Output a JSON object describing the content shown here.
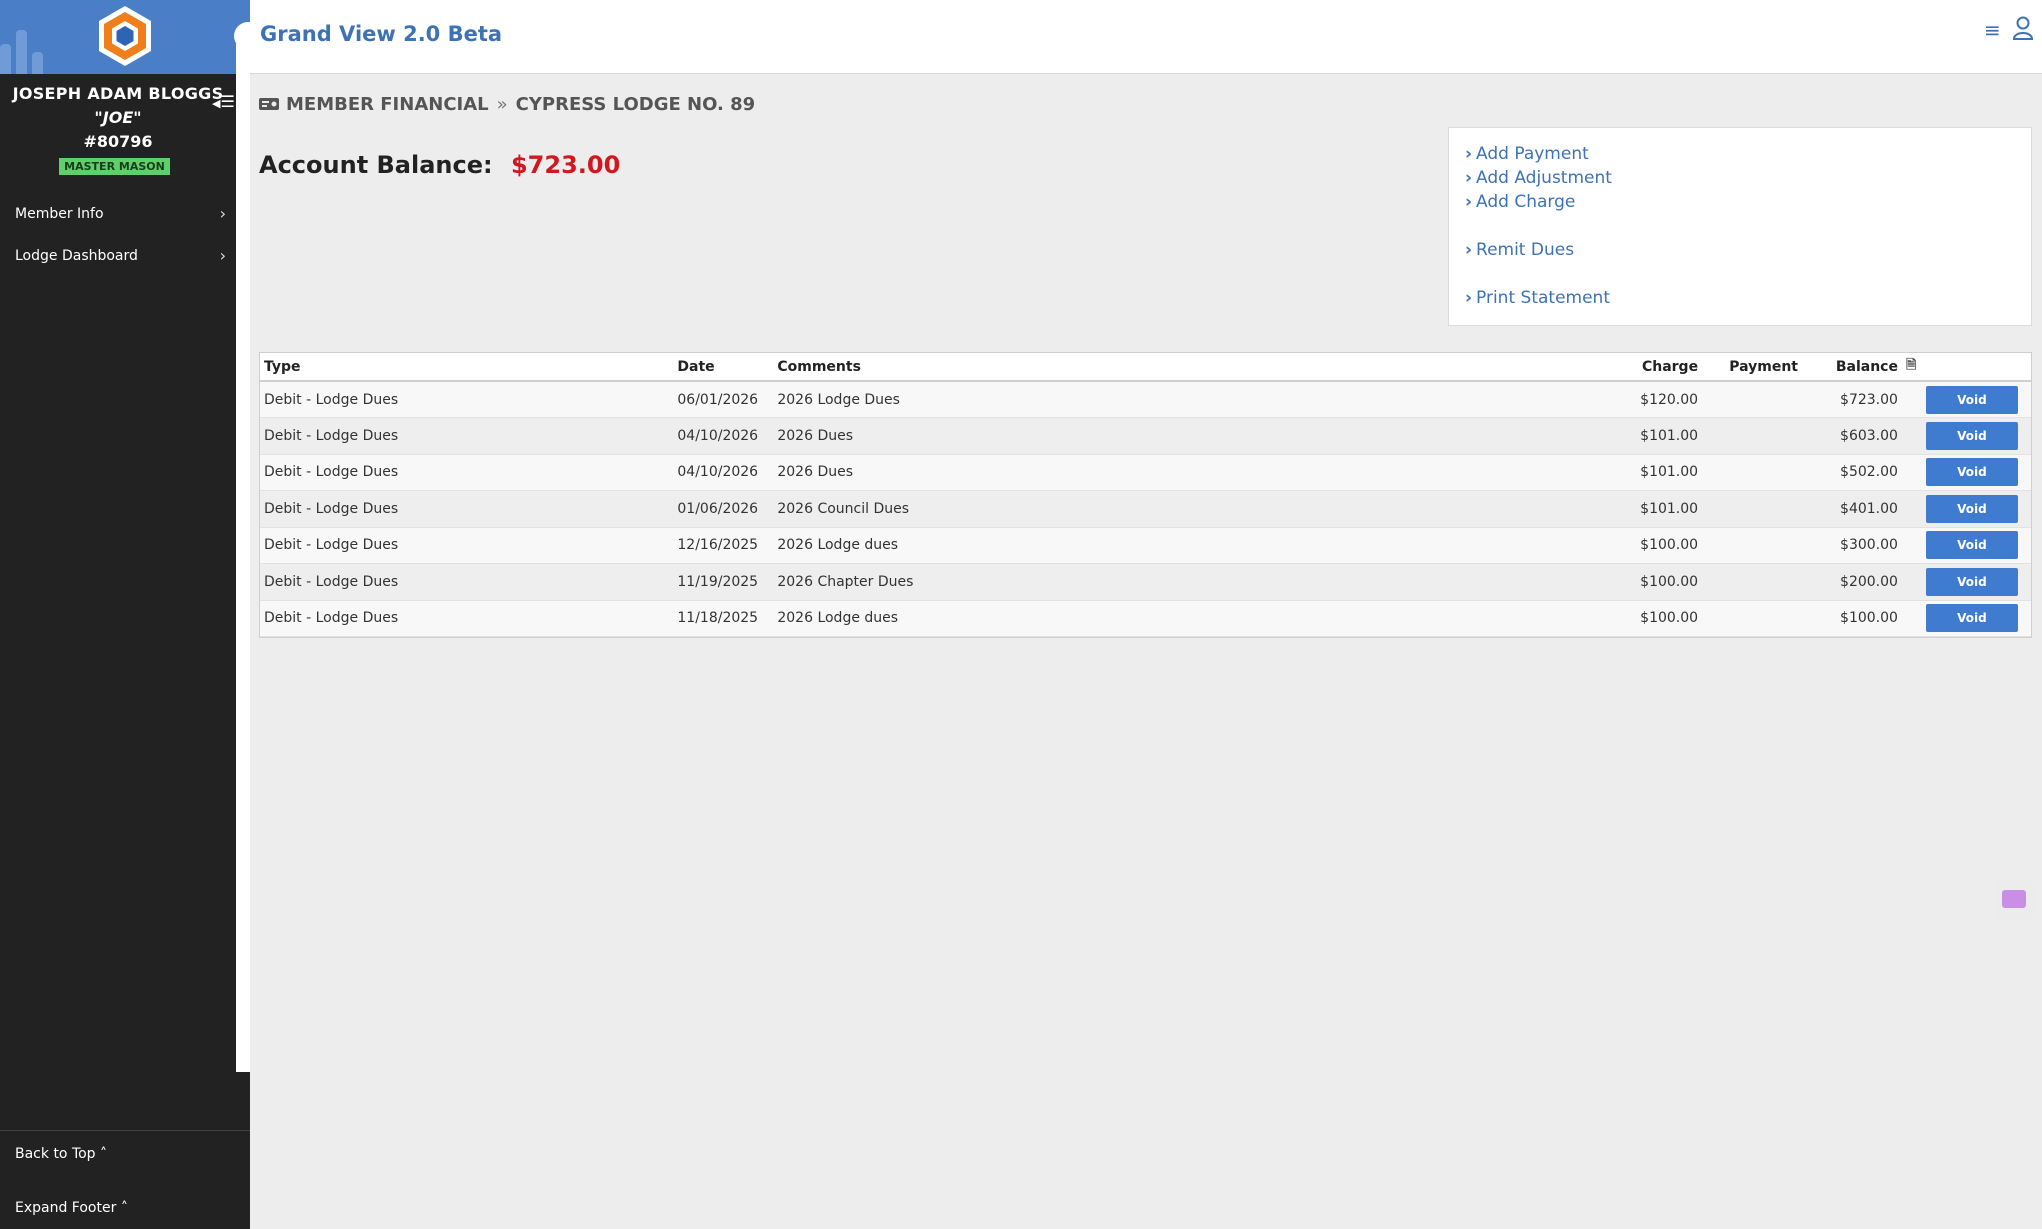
{
  "app": {
    "title": "Grand View 2.0 Beta"
  },
  "member": {
    "name": "JOSEPH ADAM BLOGGS",
    "nickname": "\"JOE\"",
    "number": "#80796",
    "rank": "MASTER MASON"
  },
  "sidebar": {
    "items": [
      {
        "label": "Member Info"
      },
      {
        "label": "Lodge Dashboard"
      }
    ],
    "back_to_top": "Back to Top",
    "expand_footer": "Expand Footer"
  },
  "breadcrumb": {
    "section": "MEMBER FINANCIAL",
    "lodge": "CYPRESS LODGE NO. 89"
  },
  "account": {
    "label": "Account Balance:",
    "value": "$723.00"
  },
  "actions": {
    "add_payment": "Add Payment",
    "add_adjustment": "Add Adjustment",
    "add_charge": "Add Charge",
    "remit_dues": "Remit Dues",
    "print_statement": "Print Statement"
  },
  "table": {
    "headers": {
      "type": "Type",
      "date": "Date",
      "comments": "Comments",
      "charge": "Charge",
      "payment": "Payment",
      "balance": "Balance"
    },
    "void_label": "Void",
    "rows": [
      {
        "type": "Debit - Lodge Dues",
        "date": "06/01/2026",
        "comments": "2026 Lodge Dues",
        "charge": "$120.00",
        "payment": "",
        "balance": "$723.00"
      },
      {
        "type": "Debit - Lodge Dues",
        "date": "04/10/2026",
        "comments": "2026 Dues",
        "charge": "$101.00",
        "payment": "",
        "balance": "$603.00"
      },
      {
        "type": "Debit - Lodge Dues",
        "date": "04/10/2026",
        "comments": "2026 Dues",
        "charge": "$101.00",
        "payment": "",
        "balance": "$502.00"
      },
      {
        "type": "Debit - Lodge Dues",
        "date": "01/06/2026",
        "comments": "2026 Council Dues",
        "charge": "$101.00",
        "payment": "",
        "balance": "$401.00"
      },
      {
        "type": "Debit - Lodge Dues",
        "date": "12/16/2025",
        "comments": "2026 Lodge dues",
        "charge": "$100.00",
        "payment": "",
        "balance": "$300.00"
      },
      {
        "type": "Debit - Lodge Dues",
        "date": "11/19/2025",
        "comments": "2026 Chapter Dues",
        "charge": "$100.00",
        "payment": "",
        "balance": "$200.00"
      },
      {
        "type": "Debit - Lodge Dues",
        "date": "11/18/2025",
        "comments": "2026 Lodge dues",
        "charge": "$100.00",
        "payment": "",
        "balance": "$100.00"
      }
    ]
  },
  "icons": {
    "logo": "hexagon-logo-icon",
    "menu": "hamburger-menu-icon",
    "user": "user-profile-icon",
    "breadcrumb": "money-bill-icon",
    "separator": "double-chevron-right-icon",
    "document": "document-icon",
    "chat": "chat-widget-icon"
  },
  "colors": {
    "brand_blue": "#3d72b4",
    "sidebar_bg": "#222222",
    "balance_red": "#d0191e",
    "void_button": "#3f7cd0",
    "badge_green": "#5fcf6a"
  }
}
